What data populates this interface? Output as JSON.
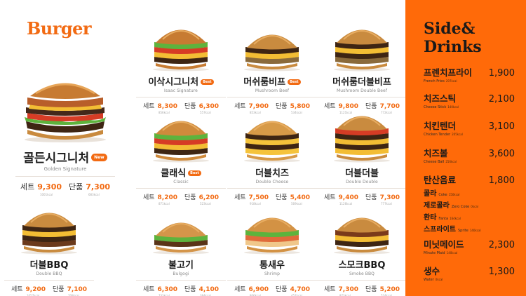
{
  "heading": "Burger",
  "featured": {
    "name": "골든시그니처",
    "name_en": "Golden Signature",
    "badge": "New",
    "set_label": "세트",
    "set_price": "9,300",
    "set_cal": "1001kcal",
    "single_label": "단품",
    "single_price": "7,300",
    "single_cal": "683kcal"
  },
  "items": [
    {
      "name": "이삭시그니처",
      "name_en": "Isaac Signature",
      "badge": "Best",
      "set_label": "세트",
      "set_price": "8,300",
      "set_cal": "856kcal",
      "single_label": "단품",
      "single_price": "6,300",
      "single_cal": "557kcal"
    },
    {
      "name": "머쉬룸비프",
      "name_en": "Mushroom Beef",
      "badge": "Best",
      "set_label": "세트",
      "set_price": "7,900",
      "set_cal": "853kcal",
      "single_label": "단품",
      "single_price": "5,800",
      "single_cal": "534kcal"
    },
    {
      "name": "머쉬룸더블비프",
      "name_en": "Mushroom Double Beef",
      "badge": "",
      "set_label": "세트",
      "set_price": "9,800",
      "set_cal": "1121kcal",
      "single_label": "단품",
      "single_price": "7,700",
      "single_cal": "772kcal"
    },
    {
      "name": "클래식",
      "name_en": "Classic",
      "badge": "Best",
      "set_label": "세트",
      "set_price": "8,200",
      "set_cal": "871kcal",
      "single_label": "단품",
      "single_price": "6,200",
      "single_cal": "523kcal"
    },
    {
      "name": "더블치즈",
      "name_en": "Double Cheese",
      "badge": "",
      "set_label": "세트",
      "set_price": "7,500",
      "set_cal": "918kcal",
      "single_label": "단품",
      "single_price": "5,400",
      "single_cal": "569kcal"
    },
    {
      "name": "더블더블",
      "name_en": "Double Double",
      "badge": "",
      "set_label": "세트",
      "set_price": "9,400",
      "set_cal": "1126kcal",
      "single_label": "단품",
      "single_price": "7,300",
      "single_cal": "777kcal"
    },
    {
      "name": "불고기",
      "name_en": "Bulgogi",
      "badge": "",
      "set_label": "세트",
      "set_price": "6,300",
      "set_cal": "733kcal",
      "single_label": "단품",
      "single_price": "4,100",
      "single_cal": "384kcal"
    },
    {
      "name": "통새우",
      "name_en": "Shrimp",
      "badge": "",
      "set_label": "세트",
      "set_price": "6,900",
      "set_cal": "806kcal",
      "single_label": "단품",
      "single_price": "4,700",
      "single_cal": "457kcal"
    },
    {
      "name": "스모크BBQ",
      "name_en": "Smoke BBQ",
      "badge": "",
      "set_label": "세트",
      "set_price": "7,300",
      "set_cal": "873kcal",
      "single_label": "단품",
      "single_price": "5,200",
      "single_cal": "524kcal"
    },
    {
      "name": "더블BBQ",
      "name_en": "Double BBQ",
      "badge": "",
      "set_label": "세트",
      "set_price": "9,200",
      "set_cal": "1057kcal",
      "single_label": "단품",
      "single_price": "7,100",
      "single_cal": "708kcal"
    }
  ],
  "side": {
    "title_line1": "Side&",
    "title_line2": "Drinks",
    "items": [
      {
        "name": "프렌치프라이",
        "price": "1,900",
        "name_en": "French Fries",
        "cal": "297kcal"
      },
      {
        "name": "치즈스틱",
        "price": "2,100",
        "name_en": "Cheese Stick",
        "cal": "140kcal"
      },
      {
        "name": "치킨텐더",
        "price": "3,100",
        "name_en": "Chicken Tender",
        "cal": "205kcal"
      },
      {
        "name": "치즈볼",
        "price": "3,600",
        "name_en": "Cheese Ball",
        "cal": "256kcal"
      },
      {
        "name": "탄산음료",
        "price": "1,800",
        "name_en": "",
        "cal": "",
        "subs": [
          {
            "name": "콜라",
            "name_en": "Coke",
            "cal": "150kcal"
          },
          {
            "name": "제로콜라",
            "name_en": "Zero Coke",
            "cal": "0kcal"
          },
          {
            "name": "환타",
            "name_en": "Fanta",
            "cal": "164kcal"
          },
          {
            "name": "스프라이트",
            "name_en": "Sprite",
            "cal": "140kcal"
          }
        ]
      },
      {
        "name": "미닛메이드",
        "price": "2,300",
        "name_en": "Minute Maid",
        "cal": "140kcal"
      },
      {
        "name": "생수",
        "price": "1,300",
        "name_en": "Water",
        "cal": "0kcal"
      }
    ]
  },
  "colors": {
    "accent": "#f26a12",
    "side_bg": "#ff6a09",
    "text": "#1b1b1b"
  },
  "icons": [
    "burger-image"
  ]
}
